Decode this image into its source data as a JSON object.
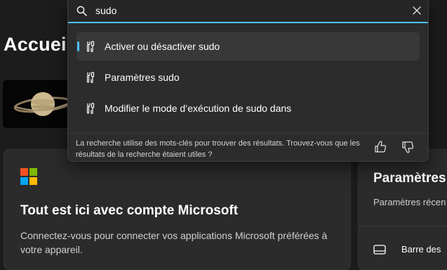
{
  "background": {
    "home_title": "Accueil",
    "microsoft_card": {
      "title": "Tout est ici avec compte Microsoft",
      "description": "Connectez-vous pour connecter vos applications Microsoft préférées à votre appareil."
    },
    "settings_card": {
      "title": "Paramètres",
      "subtitle": "Paramètres récen",
      "item_taskbar": "Barre des"
    }
  },
  "search": {
    "query": "sudo",
    "results": [
      {
        "label": "Activer ou désactiver sudo",
        "icon": "settings-tools-icon",
        "selected": true
      },
      {
        "label": "Paramètres sudo",
        "icon": "settings-tools-icon",
        "selected": false
      },
      {
        "label": "Modifier le mode d’exécution de sudo dans",
        "icon": "settings-tools-icon",
        "selected": false
      }
    ],
    "feedback_text": "La recherche utilise des mots-clés pour trouver des résultats. Trouvez-vous que les résultats de la recherche étaient utiles ?"
  },
  "colors": {
    "accent": "#4cc2ff",
    "ms_red": "#f25022",
    "ms_green": "#7fba00",
    "ms_blue": "#00a4ef",
    "ms_yellow": "#ffb900"
  }
}
